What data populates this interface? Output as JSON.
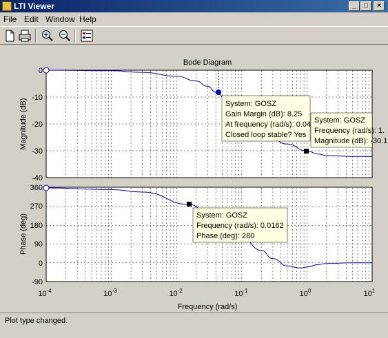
{
  "window": {
    "title": "LTI Viewer",
    "minimize": "_",
    "maximize": "□",
    "close": "×"
  },
  "menu": [
    {
      "label": "File"
    },
    {
      "label": "Edit"
    },
    {
      "label": "Window"
    },
    {
      "label": "Help"
    }
  ],
  "toolbar": {
    "icons": [
      "new-icon",
      "print-icon",
      "zoom-in-icon",
      "zoom-out-icon",
      "grid-icon"
    ]
  },
  "plot": {
    "title": "Bode Diagram",
    "xlabel": "Frequency  (rad/s)",
    "mag_ylabel": "Magnitude (dB)",
    "phase_ylabel": "Phase (deg)",
    "mag_ticks": [
      "0",
      "-10",
      "-20",
      "-30",
      "-40"
    ],
    "phase_ticks": [
      "360",
      "270",
      "180",
      "90",
      "0",
      "-90"
    ],
    "x_tick_bases": [
      "10",
      "10",
      "10",
      "10",
      "10",
      "10"
    ],
    "x_tick_exps": [
      "-4",
      "-3",
      "-2",
      "-1",
      "0",
      "1"
    ],
    "datatips": {
      "gain_margin": {
        "line1": "System: GOSZ",
        "line2": "Gain Margin (dB): 8.25",
        "line3": "At frequency (rad/s): 0.04",
        "line4": "Closed loop stable? Yes"
      },
      "mag_point": {
        "line1": "System: GOSZ",
        "line2": "Frequency (rad/s): 1.",
        "line3": "Magnitude (dB): -30.1"
      },
      "phase_point": {
        "line1": "System: GOSZ",
        "line2": "Frequency (rad/s): 0.0162",
        "line3": "Phase (deg): 280"
      }
    },
    "line_color": "#0000c0"
  },
  "chart_data": {
    "type": "line",
    "title": "Bode Diagram",
    "xscale": "log",
    "xlim": [
      0.0001,
      10
    ],
    "xlabel": "Frequency  (rad/s)",
    "grid": true,
    "magnitude": {
      "ylabel": "Magnitude (dB)",
      "ylim": [
        -40,
        0
      ],
      "x": [
        0.0001,
        0.001,
        0.003,
        0.01,
        0.02,
        0.03,
        0.0405,
        0.06,
        0.1,
        0.2,
        0.5,
        1,
        1.5,
        2,
        5,
        10
      ],
      "y": [
        0,
        -0.2,
        -0.8,
        -2.2,
        -4,
        -6,
        -8.25,
        -11.5,
        -16,
        -22,
        -27.5,
        -30.1,
        -31.2,
        -31.8,
        -32.1,
        -32.1
      ]
    },
    "phase": {
      "ylabel": "Phase (deg)",
      "ylim": [
        -90,
        360
      ],
      "x": [
        0.0001,
        0.001,
        0.003,
        0.0162,
        0.03,
        0.05,
        0.1,
        0.2,
        0.3,
        0.5,
        0.8,
        1,
        1.5,
        2,
        5,
        10
      ],
      "y": [
        360,
        352,
        340,
        280,
        235,
        180,
        120,
        60,
        20,
        -15,
        -25,
        -20,
        -8,
        -3,
        0,
        0
      ]
    }
  }
}
